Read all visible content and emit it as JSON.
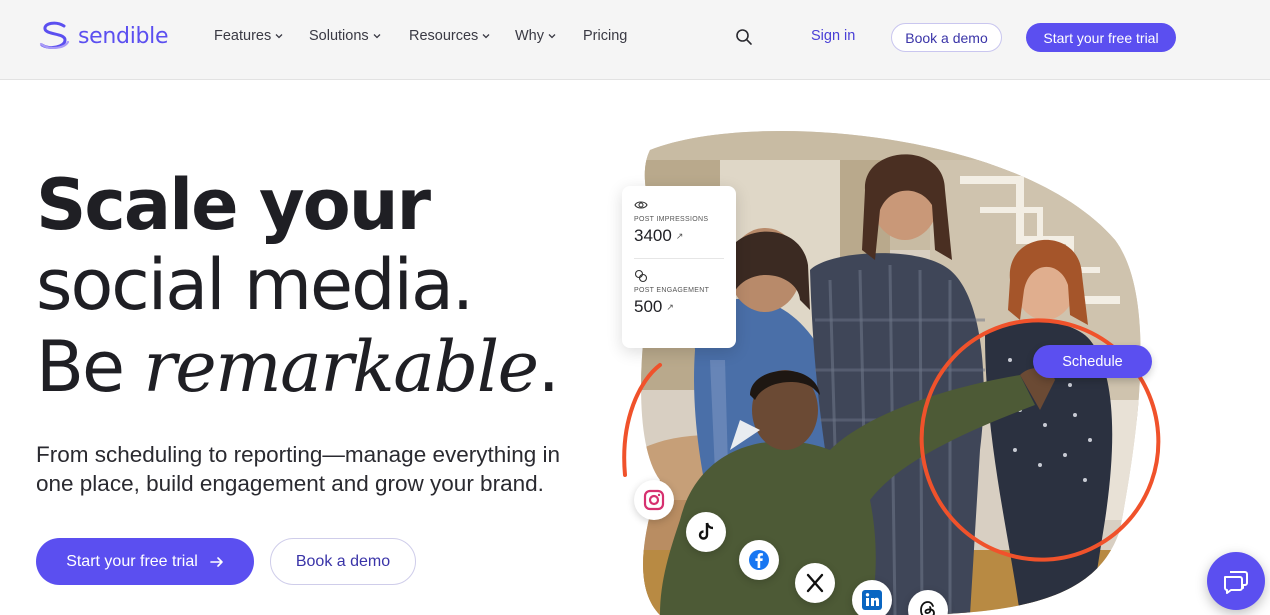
{
  "brand": {
    "name": "sendible",
    "accent": "#5b4ff0"
  },
  "nav": {
    "items": [
      {
        "label": "Features",
        "has_dropdown": true
      },
      {
        "label": "Solutions",
        "has_dropdown": true
      },
      {
        "label": "Resources",
        "has_dropdown": true
      },
      {
        "label": "Why",
        "has_dropdown": true
      },
      {
        "label": "Pricing",
        "has_dropdown": false
      }
    ],
    "search_icon": "search-icon",
    "sign_in": "Sign in",
    "book_demo": "Book a demo",
    "free_trial": "Start your free trial"
  },
  "hero": {
    "line1": "Scale your",
    "line2": "social media.",
    "line3_prefix": "Be ",
    "line3_emphasis": "remarkable",
    "line3_suffix": ".",
    "subtitle": "From scheduling to reporting—manage everything in one place, build engagement and grow your brand.",
    "cta_primary": "Start your free trial",
    "cta_primary_icon": "arrow-right-icon",
    "cta_secondary": "Book a demo"
  },
  "metrics": {
    "impressions_label": "POST IMPRESSIONS",
    "impressions_value": "3400",
    "engagement_label": "POST ENGAGEMENT",
    "engagement_value": "500"
  },
  "schedule_chip": "Schedule",
  "social_icons": [
    "instagram-icon",
    "tiktok-icon",
    "facebook-icon",
    "x-icon",
    "linkedin-icon",
    "threads-icon"
  ],
  "chat_icon": "chat-icon"
}
